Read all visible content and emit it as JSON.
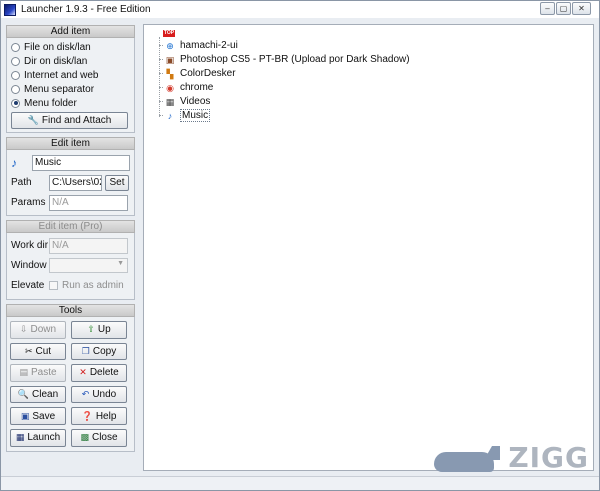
{
  "window": {
    "title": "Launcher 1.9.3 - Free Edition",
    "controls": {
      "minimize": "–",
      "maximize": "▢",
      "close": "✕"
    }
  },
  "add_item": {
    "header": "Add item",
    "options": [
      {
        "label": "File on disk/lan",
        "checked": false
      },
      {
        "label": "Dir on disk/lan",
        "checked": false
      },
      {
        "label": "Internet and web",
        "checked": false
      },
      {
        "label": "Menu separator",
        "checked": false
      },
      {
        "label": "Menu folder",
        "checked": true
      }
    ],
    "find_button": "Find and Attach"
  },
  "edit_item": {
    "header": "Edit item",
    "name_value": "Music",
    "path_label": "Path",
    "path_value": "C:\\Users\\02\\",
    "set_button": "Set",
    "params_label": "Params",
    "params_placeholder": "N/A"
  },
  "edit_item_pro": {
    "header": "Edit item (Pro)",
    "workdir_label": "Work dir",
    "workdir_placeholder": "N/A",
    "window_label": "Window",
    "elevate_label": "Elevate",
    "run_as_admin_label": "Run as admin"
  },
  "tools": {
    "header": "Tools",
    "buttons": [
      {
        "label": "Down",
        "icon": "arrow-down-icon",
        "enabled": false
      },
      {
        "label": "Up",
        "icon": "arrow-up-icon",
        "enabled": true
      },
      {
        "label": "Cut",
        "icon": "scissors-icon",
        "enabled": true
      },
      {
        "label": "Copy",
        "icon": "copy-icon",
        "enabled": true
      },
      {
        "label": "Paste",
        "icon": "paste-icon",
        "enabled": false
      },
      {
        "label": "Delete",
        "icon": "delete-icon",
        "enabled": true
      },
      {
        "label": "Clean",
        "icon": "magnifier-icon",
        "enabled": true
      },
      {
        "label": "Undo",
        "icon": "undo-icon",
        "enabled": true
      },
      {
        "label": "Save",
        "icon": "floppy-icon",
        "enabled": true
      },
      {
        "label": "Help",
        "icon": "help-icon",
        "enabled": true
      },
      {
        "label": "Launch",
        "icon": "launch-icon",
        "enabled": true
      },
      {
        "label": "Close",
        "icon": "close-app-icon",
        "enabled": true
      }
    ]
  },
  "tree": {
    "root_badge": "TOP",
    "items": [
      {
        "label": "hamachi-2-ui",
        "icon": "hamachi-icon",
        "selected": false
      },
      {
        "label": "Photoshop CS5 - PT-BR (Upload por Dark Shadow)",
        "icon": "photoshop-icon",
        "selected": false
      },
      {
        "label": "ColorDesker",
        "icon": "colordesker-icon",
        "selected": false
      },
      {
        "label": "chrome",
        "icon": "chrome-icon",
        "selected": false
      },
      {
        "label": "Videos",
        "icon": "video-icon",
        "selected": false
      },
      {
        "label": "Music",
        "icon": "music-note-icon",
        "selected": true
      }
    ]
  },
  "watermark": {
    "text": "ZIGG"
  },
  "colors": {
    "accent": "#1f3c6e",
    "panel": "#e9edf2",
    "tree_bg": "#ffffff"
  }
}
